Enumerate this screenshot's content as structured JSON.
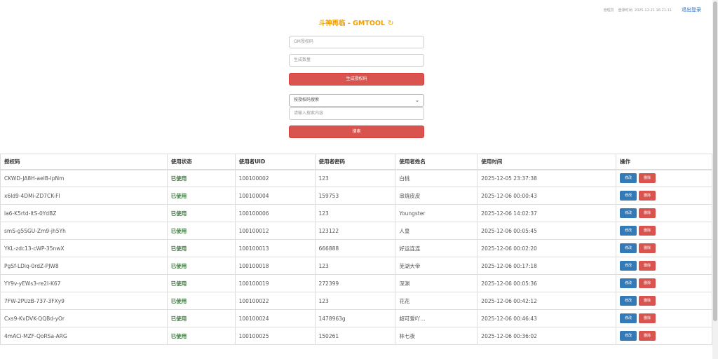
{
  "header": {
    "title": "斗神再临 - GMTOOL",
    "user_label": "管理员",
    "login_time": "登录时间: 2025-12-21 16:21:11",
    "logout_label": "退出登录"
  },
  "form": {
    "auth_code_placeholder": "GM授权码",
    "quantity_placeholder": "生成数量",
    "generate_label": "生成授权码",
    "search_type_selected": "按授权码搜索",
    "search_placeholder": "请输入搜索内容",
    "search_label": "搜索"
  },
  "table": {
    "headers": [
      "授权码",
      "使用状态",
      "使用者UID",
      "使用者密码",
      "使用者姓名",
      "使用时间",
      "操作"
    ],
    "edit_label": "修改",
    "delete_label": "删除",
    "rows": [
      {
        "code": "CKWD-JA8H-aelB-lpNm",
        "status": "已使用",
        "uid": "100100002",
        "password": "123",
        "name": "白桃",
        "time": "2025-12-05 23:37:38"
      },
      {
        "code": "x6ld9-4DMi-ZD7CK-FI",
        "status": "已使用",
        "uid": "100100004",
        "password": "159753",
        "name": "串烧皮皮",
        "time": "2025-12-06 00:00:43"
      },
      {
        "code": "la6-K5rtd-ItS-0YdBZ",
        "status": "已使用",
        "uid": "100100006",
        "password": "123",
        "name": "Youngster",
        "time": "2025-12-06 14:02:37"
      },
      {
        "code": "smS-g5SGU-Zm9-jh5Yh",
        "status": "已使用",
        "uid": "100100012",
        "password": "123122",
        "name": "人皇",
        "time": "2025-12-06 00:05:45"
      },
      {
        "code": "YKL-zdc13-cWP-35nwX",
        "status": "已使用",
        "uid": "100100013",
        "password": "666888",
        "name": "好运连连",
        "time": "2025-12-06 00:02:20"
      },
      {
        "code": "PgSf-LDiq-0rdZ-PJW8",
        "status": "已使用",
        "uid": "100100018",
        "password": "123",
        "name": "芜湖大帝",
        "time": "2025-12-06 00:17:18"
      },
      {
        "code": "YY9v-yEWs3-re2I-K67",
        "status": "已使用",
        "uid": "100100019",
        "password": "272399",
        "name": "深渊",
        "time": "2025-12-06 00:05:36"
      },
      {
        "code": "7FW-2PUzB-737-3FXy9",
        "status": "已使用",
        "uid": "100100022",
        "password": "123",
        "name": "花花",
        "time": "2025-12-06 00:42:12"
      },
      {
        "code": "Cxs9-KvDVK-QQBd-yOr",
        "status": "已使用",
        "uid": "100100024",
        "password": "1478963g",
        "name": "超可爱吖...",
        "time": "2025-12-06 00:46:43"
      },
      {
        "code": "4mACi-MZF-QoRSa-ARG",
        "status": "已使用",
        "uid": "100100025",
        "password": "150261",
        "name": "林七夜",
        "time": "2025-12-06 00:36:02"
      }
    ]
  }
}
